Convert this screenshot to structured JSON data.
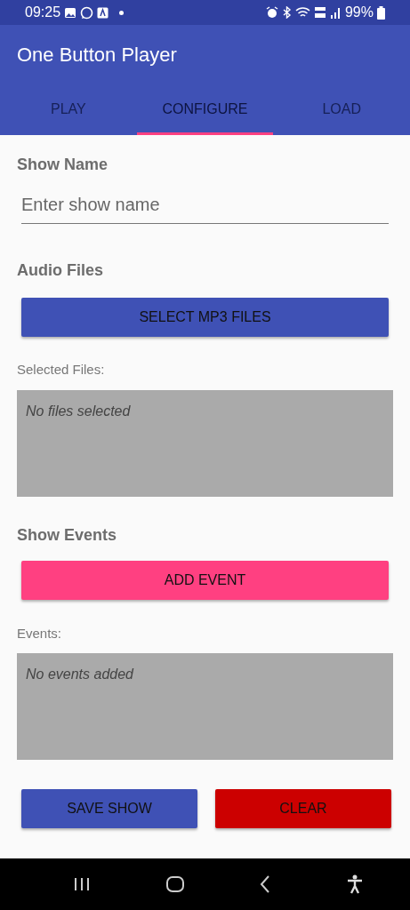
{
  "status_bar": {
    "time": "09:25",
    "battery": "99%"
  },
  "app_bar": {
    "title": "One Button Player"
  },
  "tabs": [
    {
      "label": "PLAY",
      "selected": false
    },
    {
      "label": "CONFIGURE",
      "selected": true
    },
    {
      "label": "LOAD",
      "selected": false
    }
  ],
  "show_name": {
    "label": "Show Name",
    "placeholder": "Enter show name"
  },
  "audio_files": {
    "label": "Audio Files",
    "button": "SELECT MP3 FILES",
    "list_label": "Selected Files:",
    "list_empty": "No files selected"
  },
  "show_events": {
    "label": "Show Events",
    "button": "ADD EVENT",
    "list_label": "Events:",
    "list_empty": "No events added"
  },
  "actions": [
    {
      "label": "SAVE SHOW",
      "kind": "primary"
    },
    {
      "label": "CLEAR",
      "kind": "danger"
    }
  ]
}
